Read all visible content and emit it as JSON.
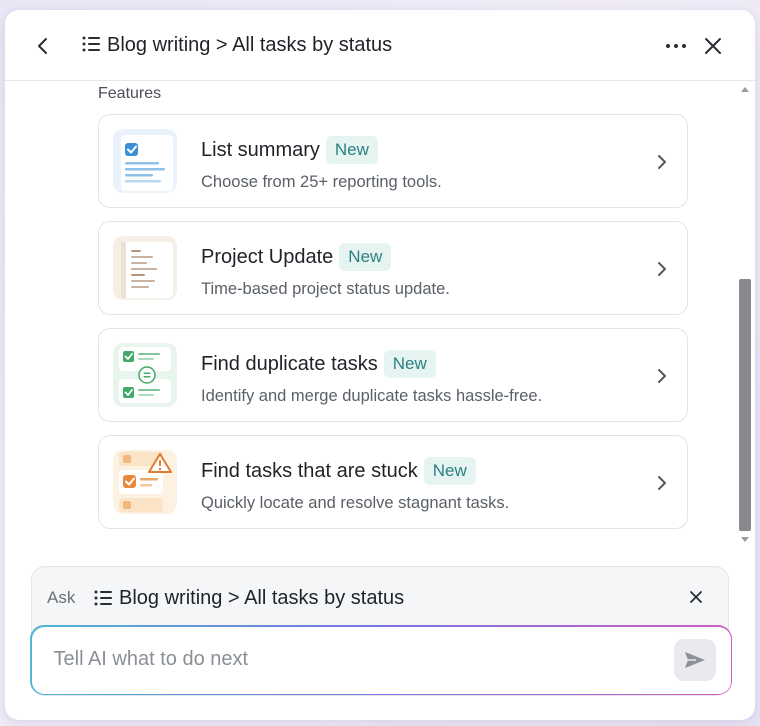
{
  "header": {
    "title": "Blog writing > All tasks by status",
    "icons": {
      "back": "chevron-left-icon",
      "list": "list-icon",
      "more": "more-horizontal-icon",
      "close": "close-icon"
    }
  },
  "features": {
    "section_label": "Features",
    "badge_label": "New",
    "cards": [
      {
        "title": "List summary",
        "badge": "New",
        "description": "Choose from 25+ reporting tools.",
        "icon": "list-summary-icon"
      },
      {
        "title": "Project Update",
        "badge": "New",
        "description": "Time-based project status update.",
        "icon": "project-update-icon"
      },
      {
        "title": "Find duplicate tasks",
        "badge": "New",
        "description": "Identify and merge duplicate tasks hassle-free.",
        "icon": "duplicate-tasks-icon"
      },
      {
        "title": "Find tasks that are stuck",
        "badge": "New",
        "description": "Quickly locate and resolve stagnant tasks.",
        "icon": "stuck-tasks-icon"
      }
    ]
  },
  "ask": {
    "label": "Ask",
    "context_title": "Blog writing > All tasks by status",
    "input_placeholder": "Tell AI what to do next",
    "input_value": ""
  },
  "colors": {
    "badge_text": "#2b7f82",
    "badge_bg": "#e5f4f1",
    "input_gradient": [
      "#4fb7d4",
      "#7b73e0",
      "#d05fc1"
    ]
  }
}
